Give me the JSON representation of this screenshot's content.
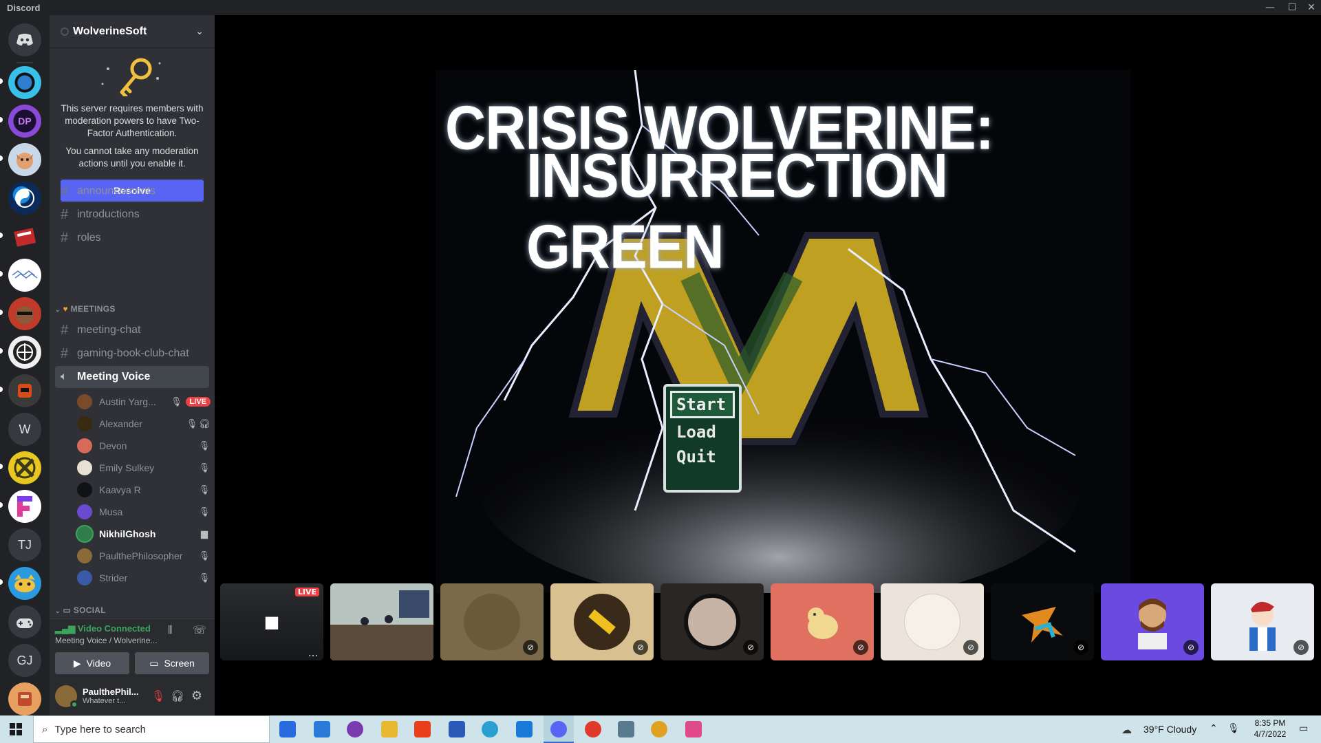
{
  "window": {
    "title": "Discord"
  },
  "server": {
    "name": "WolverineSoft",
    "notice_text_1": "This server requires members with moderation powers to have Two-Factor Authentication.",
    "notice_text_2": "You cannot take any moderation actions until you enable it.",
    "resolve_label": "Resolve"
  },
  "guild_letters": {
    "w": "W",
    "tj": "TJ",
    "gj": "GJ"
  },
  "channels": {
    "announcements": "announcements",
    "introductions": "introductions",
    "roles": "roles",
    "meetings_category": "MEETINGS",
    "meeting_chat": "meeting-chat",
    "gaming_book_club_chat": "gaming-book-club-chat",
    "meeting_voice": "Meeting Voice",
    "social_category": "SOCIAL"
  },
  "voice_users": [
    {
      "name": "Austin Yarg...",
      "color": "#7a4a2a",
      "badge": "LIVE"
    },
    {
      "name": "Alexander",
      "color": "#3a2a10"
    },
    {
      "name": "Devon",
      "color": "#d86a5a"
    },
    {
      "name": "Emily Sulkey",
      "color": "#e8e0d5"
    },
    {
      "name": "Kaavya R",
      "color": "#101215"
    },
    {
      "name": "Musa",
      "color": "#6a4ad0"
    },
    {
      "name": "NikhilGhosh",
      "color": "#2e7d4a"
    },
    {
      "name": "PaulthePhilosopher",
      "color": "#8b6a3a"
    },
    {
      "name": "Strider",
      "color": "#3a5aa8"
    }
  ],
  "rtc": {
    "status": "Video Connected",
    "channel": "Meeting Voice / Wolverine...",
    "video_label": "Video",
    "screen_label": "Screen"
  },
  "user": {
    "name": "PaulthePhil...",
    "status": "Whatever t..."
  },
  "stream": {
    "title_line1": "CRISIS WOLVERINE:",
    "title_line2": "INSURRECTION GREEN",
    "menu": [
      "Start",
      "Load",
      "Quit"
    ],
    "live_badge": "LIVE"
  },
  "taskbar": {
    "search_placeholder": "Type here to search",
    "weather": "39°F  Cloudy",
    "time": "8:35 PM",
    "date": "4/7/2022"
  },
  "colors": {
    "blurple": "#5865f2",
    "live_red": "#ed4245",
    "online_green": "#3ba55d",
    "maize": "#e8c020"
  }
}
